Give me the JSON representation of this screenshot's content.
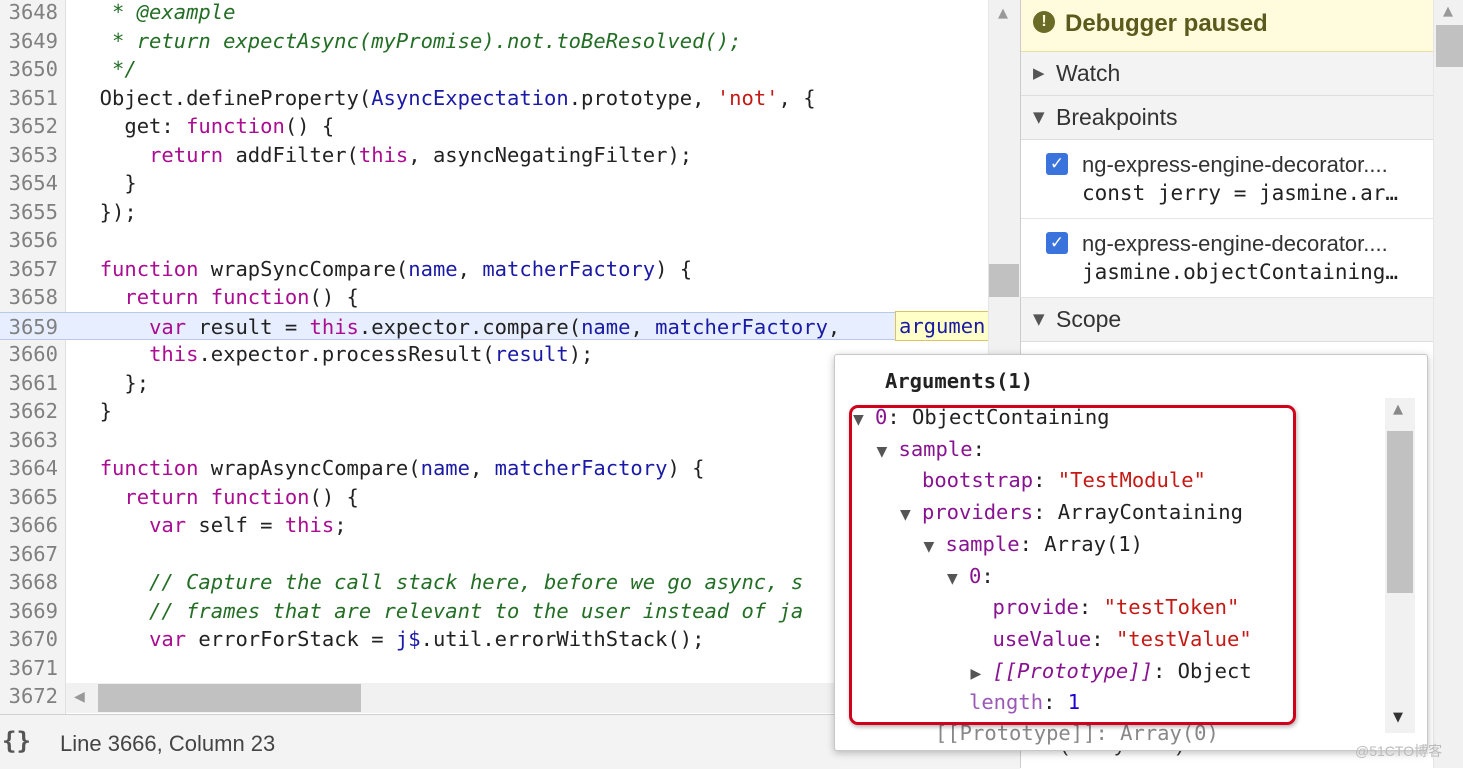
{
  "editor": {
    "lines": [
      {
        "no": "3648",
        "parts": [
          {
            "t": "   * @example",
            "c": "cm"
          }
        ]
      },
      {
        "no": "3649",
        "parts": [
          {
            "t": "   * return expectAsync(myPromise).not.toBeResolved();",
            "c": "cm"
          }
        ]
      },
      {
        "no": "3650",
        "parts": [
          {
            "t": "   */",
            "c": "cm"
          }
        ]
      },
      {
        "no": "3651",
        "parts": [
          {
            "t": "  Object.defineProperty(",
            "c": "pl"
          },
          {
            "t": "AsyncExpectation",
            "c": "vr"
          },
          {
            "t": ".prototype, ",
            "c": "pl"
          },
          {
            "t": "'not'",
            "c": "st"
          },
          {
            "t": ", {",
            "c": "pl"
          }
        ]
      },
      {
        "no": "3652",
        "parts": [
          {
            "t": "    get: ",
            "c": "pl"
          },
          {
            "t": "function",
            "c": "kw"
          },
          {
            "t": "() {",
            "c": "pl"
          }
        ]
      },
      {
        "no": "3653",
        "parts": [
          {
            "t": "      ",
            "c": "pl"
          },
          {
            "t": "return",
            "c": "kw"
          },
          {
            "t": " addFilter(",
            "c": "pl"
          },
          {
            "t": "this",
            "c": "kw"
          },
          {
            "t": ", asyncNegatingFilter);",
            "c": "pl"
          }
        ]
      },
      {
        "no": "3654",
        "parts": [
          {
            "t": "    }",
            "c": "pl"
          }
        ]
      },
      {
        "no": "3655",
        "parts": [
          {
            "t": "  });",
            "c": "pl"
          }
        ]
      },
      {
        "no": "3656",
        "parts": [
          {
            "t": "",
            "c": "pl"
          }
        ]
      },
      {
        "no": "3657",
        "parts": [
          {
            "t": "  ",
            "c": "pl"
          },
          {
            "t": "function",
            "c": "kw"
          },
          {
            "t": " wrapSyncCompare(",
            "c": "pl"
          },
          {
            "t": "name",
            "c": "vr"
          },
          {
            "t": ", ",
            "c": "pl"
          },
          {
            "t": "matcherFactory",
            "c": "vr"
          },
          {
            "t": ") {",
            "c": "pl"
          }
        ]
      },
      {
        "no": "3658",
        "parts": [
          {
            "t": "    ",
            "c": "pl"
          },
          {
            "t": "return",
            "c": "kw"
          },
          {
            "t": " ",
            "c": "pl"
          },
          {
            "t": "function",
            "c": "kw"
          },
          {
            "t": "() {",
            "c": "pl"
          }
        ]
      },
      {
        "no": "3659",
        "exec": true,
        "parts": [
          {
            "t": "      ",
            "c": "pl"
          },
          {
            "t": "var",
            "c": "kw"
          },
          {
            "t": " result = ",
            "c": "pl"
          },
          {
            "t": "this",
            "c": "kw"
          },
          {
            "t": ".expector.compare(",
            "c": "pl"
          },
          {
            "t": "name",
            "c": "vr"
          },
          {
            "t": ", ",
            "c": "pl"
          },
          {
            "t": "matcherFactory",
            "c": "vr"
          },
          {
            "t": ", ",
            "c": "pl"
          }
        ]
      },
      {
        "no": "3660",
        "parts": [
          {
            "t": "      ",
            "c": "pl"
          },
          {
            "t": "this",
            "c": "kw"
          },
          {
            "t": ".expector.processResult(",
            "c": "pl"
          },
          {
            "t": "result",
            "c": "vr"
          },
          {
            "t": ");",
            "c": "pl"
          }
        ]
      },
      {
        "no": "3661",
        "parts": [
          {
            "t": "    };",
            "c": "pl"
          }
        ]
      },
      {
        "no": "3662",
        "parts": [
          {
            "t": "  }",
            "c": "pl"
          }
        ]
      },
      {
        "no": "3663",
        "parts": [
          {
            "t": "",
            "c": "pl"
          }
        ]
      },
      {
        "no": "3664",
        "parts": [
          {
            "t": "  ",
            "c": "pl"
          },
          {
            "t": "function",
            "c": "kw"
          },
          {
            "t": " wrapAsyncCompare(",
            "c": "pl"
          },
          {
            "t": "name",
            "c": "vr"
          },
          {
            "t": ", ",
            "c": "pl"
          },
          {
            "t": "matcherFactory",
            "c": "vr"
          },
          {
            "t": ") {",
            "c": "pl"
          }
        ]
      },
      {
        "no": "3665",
        "parts": [
          {
            "t": "    ",
            "c": "pl"
          },
          {
            "t": "return",
            "c": "kw"
          },
          {
            "t": " ",
            "c": "pl"
          },
          {
            "t": "function",
            "c": "kw"
          },
          {
            "t": "() {",
            "c": "pl"
          }
        ]
      },
      {
        "no": "3666",
        "parts": [
          {
            "t": "      ",
            "c": "pl"
          },
          {
            "t": "var",
            "c": "kw"
          },
          {
            "t": " self = ",
            "c": "pl"
          },
          {
            "t": "this",
            "c": "kw"
          },
          {
            "t": ";",
            "c": "pl"
          }
        ]
      },
      {
        "no": "3667",
        "parts": [
          {
            "t": "",
            "c": "pl"
          }
        ]
      },
      {
        "no": "3668",
        "parts": [
          {
            "t": "      // Capture the call stack here, before we go async, s",
            "c": "cm"
          }
        ]
      },
      {
        "no": "3669",
        "parts": [
          {
            "t": "      // frames that are relevant to the user instead of ja",
            "c": "cm"
          }
        ]
      },
      {
        "no": "3670",
        "parts": [
          {
            "t": "      ",
            "c": "pl"
          },
          {
            "t": "var",
            "c": "kw"
          },
          {
            "t": " errorForStack = ",
            "c": "pl"
          },
          {
            "t": "j$",
            "c": "vr"
          },
          {
            "t": ".util.errorWithStack();",
            "c": "pl"
          }
        ]
      },
      {
        "no": "3671",
        "parts": [
          {
            "t": "",
            "c": "pl"
          }
        ]
      },
      {
        "no": "3672",
        "parts": [
          {
            "t": "",
            "c": "pl"
          }
        ]
      }
    ],
    "hover_token": "argumen"
  },
  "status": {
    "pretty_print": "{}",
    "cursor": "Line 3666, Column 23"
  },
  "panel": {
    "paused_label": "Debugger paused",
    "watch_label": "Watch",
    "breakpoints_label": "Breakpoints",
    "scope_label": "Scope",
    "breakpoints": [
      {
        "file": "ng-express-engine-decorator....",
        "source": "const jerry = jasmine.ar…",
        "checked": true
      },
      {
        "file": "ng-express-engine-decorator....",
        "source": "jasmine.objectContaining…",
        "checked": true
      }
    ],
    "callstack_peek": "(anonymous)"
  },
  "popover": {
    "title": "Arguments(1)",
    "rows": [
      {
        "indent": 0,
        "tri": "▼",
        "parts": [
          {
            "t": "0",
            "c": "kp"
          },
          {
            "t": ": ObjectContaining",
            "c": "kd"
          }
        ]
      },
      {
        "indent": 1,
        "tri": "▼",
        "parts": [
          {
            "t": "sample",
            "c": "kp"
          },
          {
            "t": ":",
            "c": "kd"
          }
        ]
      },
      {
        "indent": 2,
        "tri": "",
        "parts": [
          {
            "t": "bootstrap",
            "c": "kp"
          },
          {
            "t": ": ",
            "c": "kd"
          },
          {
            "t": "\"TestModule\"",
            "c": "ks"
          }
        ]
      },
      {
        "indent": 2,
        "tri": "▼",
        "parts": [
          {
            "t": "providers",
            "c": "kp"
          },
          {
            "t": ": ArrayContaining",
            "c": "kd"
          }
        ]
      },
      {
        "indent": 3,
        "tri": "▼",
        "parts": [
          {
            "t": "sample",
            "c": "kp"
          },
          {
            "t": ": Array(1)",
            "c": "kd"
          }
        ]
      },
      {
        "indent": 4,
        "tri": "▼",
        "parts": [
          {
            "t": "0",
            "c": "kp"
          },
          {
            "t": ":",
            "c": "kd"
          }
        ]
      },
      {
        "indent": 5,
        "tri": "",
        "parts": [
          {
            "t": "provide",
            "c": "kp"
          },
          {
            "t": ": ",
            "c": "kd"
          },
          {
            "t": "\"testToken\"",
            "c": "ks"
          }
        ]
      },
      {
        "indent": 5,
        "tri": "",
        "parts": [
          {
            "t": "useValue",
            "c": "kp"
          },
          {
            "t": ": ",
            "c": "kd"
          },
          {
            "t": "\"testValue\"",
            "c": "ks"
          }
        ]
      },
      {
        "indent": 5,
        "tri": "▶",
        "parts": [
          {
            "t": "[[Prototype]]",
            "c": "kpr"
          },
          {
            "t": ": Object",
            "c": "kd"
          }
        ]
      },
      {
        "indent": 4,
        "tri": "",
        "parts": [
          {
            "t": "length",
            "c": "kl"
          },
          {
            "t": ": ",
            "c": "kd"
          },
          {
            "t": "1",
            "c": "kn"
          }
        ]
      }
    ],
    "cut_row": "[[Prototype]]: Array(0)"
  },
  "watermark": "@51CTO博客"
}
